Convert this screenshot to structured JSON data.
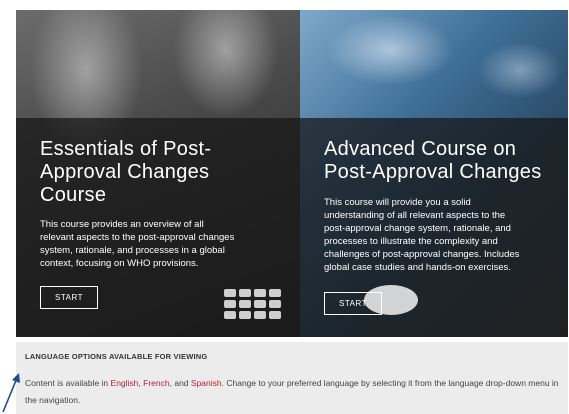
{
  "cards": [
    {
      "title": "Essentials of Post-\nApproval Changes\nCourse",
      "description": "This course provides an overview of all\nrelevant aspects to the post-approval changes\nsystem, rationale, and processes in a global\ncontext, focusing on WHO provisions.",
      "button_label": "START"
    },
    {
      "title": "Advanced Course on\nPost-Approval Changes",
      "description": "This course will provide you a solid\nunderstanding of all relevant aspects to the\npost-approval change system, rationale, and\nprocesses to illustrate the complexity and\nchallenges of post-approval changes. Includes\nglobal case studies and hands-on exercises.",
      "button_label": "START"
    }
  ],
  "language_panel": {
    "heading": "LANGUAGE OPTIONS AVAILABLE FOR VIEWING",
    "text_before": "Content is available in ",
    "links": [
      "English",
      "French",
      "Spanish"
    ],
    "sep1": ", ",
    "sep2": ", and ",
    "text_after": ". Change to your preferred language by selecting it from the language drop-down menu in the navigation.",
    "link_color": "#b51f3a"
  },
  "colors": {
    "overlay": "#161616",
    "panel_bg": "#ececec",
    "arrow": "#1f4e8c"
  }
}
